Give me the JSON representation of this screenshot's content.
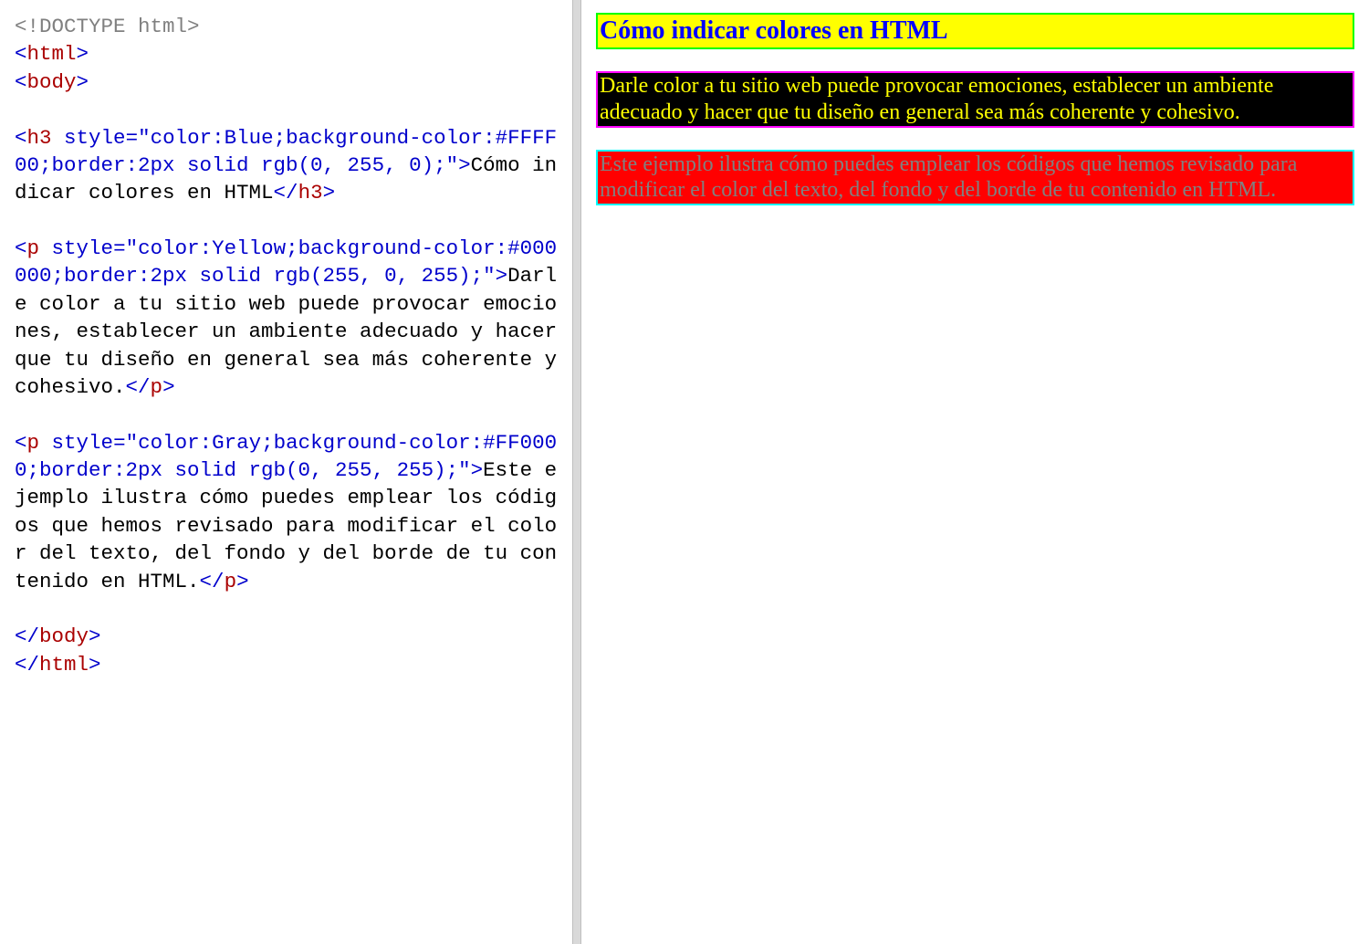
{
  "code": {
    "l1_doctype": "<!DOCTYPE html>",
    "l2_open_html": "html",
    "l3_open_body": "body",
    "h3_tag": "h3",
    "h3_attr_name": "style",
    "h3_attr_val": "\"color:Blue;background-color:#FFFF00;border:2px solid rgb(0, 255, 0);\"",
    "h3_text": "Cómo indicar colores en HTML",
    "p_tag": "p",
    "p1_attr_name": "style",
    "p1_attr_val": "\"color:Yellow;background-color:#000000;border:2px solid rgb(255, 0, 255);\"",
    "p1_text": "Darle color a tu sitio web puede provocar emociones, establecer un ambiente adecuado y hacer que tu diseño en general sea más coherente y cohesivo.",
    "p2_attr_name": "style",
    "p2_attr_val": "\"color:Gray;background-color:#FF0000;border:2px solid rgb(0, 255, 255);\"",
    "p2_text": "Este ejemplo ilustra cómo puedes emplear los códigos que hemos revisado para modificar el color del texto, del fondo y del borde de tu contenido en HTML.",
    "close_body": "body",
    "close_html": "html",
    "lt": "<",
    "gt": ">",
    "lt_slash": "</",
    "eq": "="
  },
  "rendered": {
    "heading": "Cómo indicar colores en HTML",
    "para1": "Darle color a tu sitio web puede provocar emociones, establecer un ambiente adecuado y hacer que tu diseño en general sea más coherente y cohesivo.",
    "para2": "Este ejemplo ilustra cómo puedes emplear los códigos que hemos revisado para modificar el color del texto, del fondo y del borde de tu contenido en HTML."
  }
}
